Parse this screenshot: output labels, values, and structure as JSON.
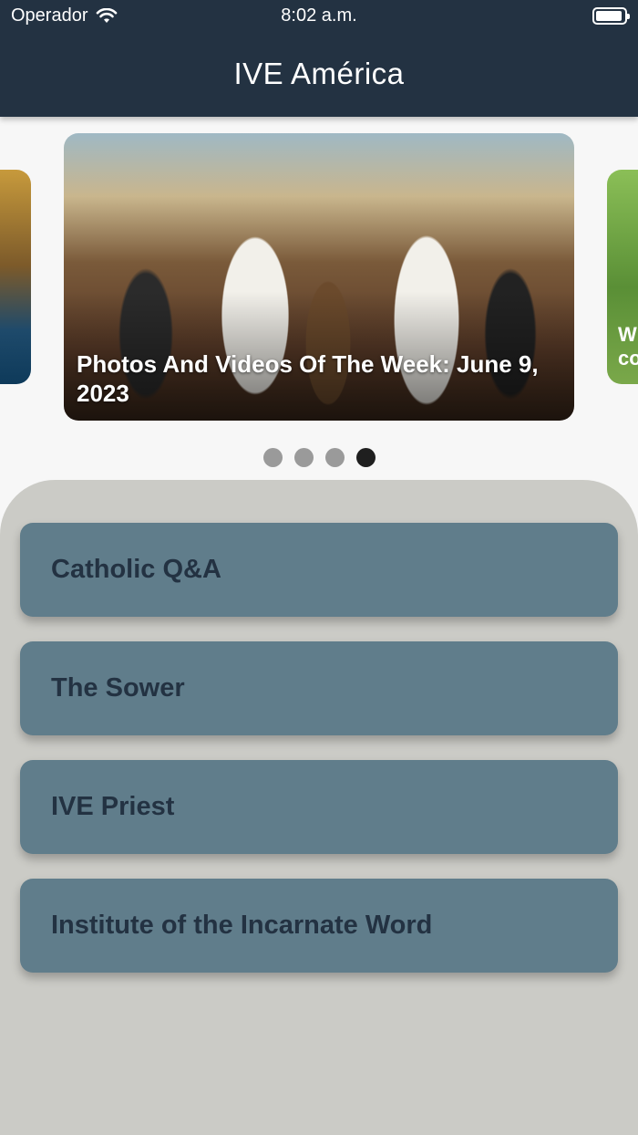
{
  "status_bar": {
    "carrier": "Operador",
    "time": "8:02 a.m."
  },
  "header": {
    "title": "IVE América"
  },
  "carousel": {
    "slides": [
      {
        "caption": ""
      },
      {
        "caption": "Photos And Videos Of The Week: June 9, 2023"
      },
      {
        "caption": "W\nco"
      }
    ],
    "dot_count": 4,
    "active_dot": 4
  },
  "menu": {
    "items": [
      {
        "label": "Catholic Q&A"
      },
      {
        "label": "The Sower"
      },
      {
        "label": "IVE Priest"
      },
      {
        "label": "Institute of the Incarnate Word"
      }
    ]
  },
  "colors": {
    "header_bg": "#233242",
    "menu_bg": "#607d8b",
    "menu_text": "#233242",
    "panel_bg": "#cbcbc6"
  }
}
